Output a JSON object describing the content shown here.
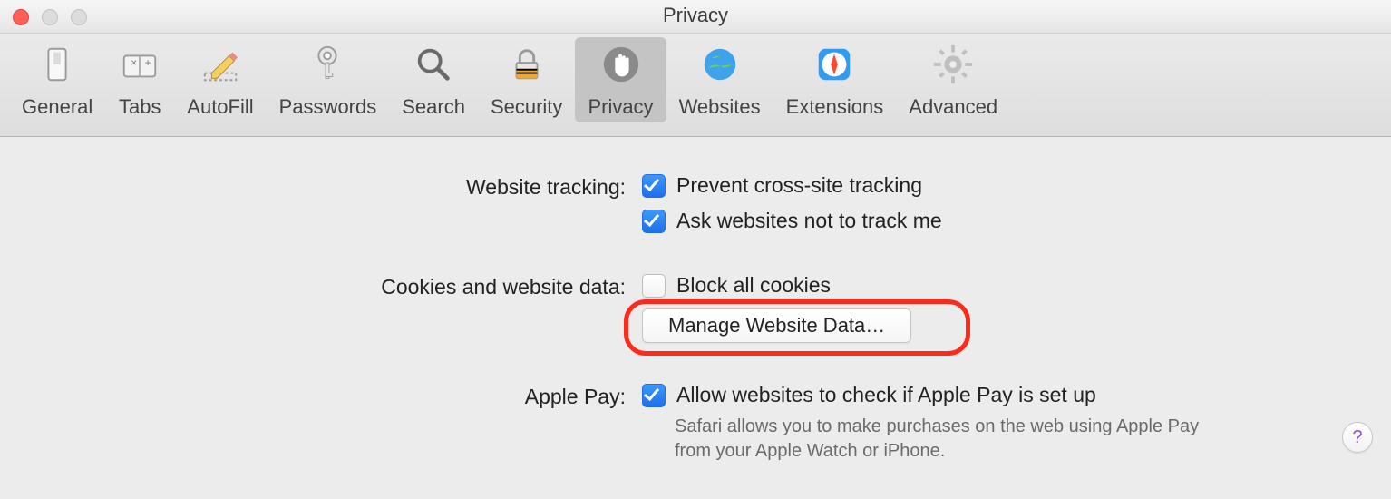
{
  "window": {
    "title": "Privacy"
  },
  "toolbar": {
    "items": [
      {
        "id": "general",
        "label": "General"
      },
      {
        "id": "tabs",
        "label": "Tabs"
      },
      {
        "id": "autofill",
        "label": "AutoFill"
      },
      {
        "id": "passwords",
        "label": "Passwords"
      },
      {
        "id": "search",
        "label": "Search"
      },
      {
        "id": "security",
        "label": "Security"
      },
      {
        "id": "privacy",
        "label": "Privacy"
      },
      {
        "id": "websites",
        "label": "Websites"
      },
      {
        "id": "extensions",
        "label": "Extensions"
      },
      {
        "id": "advanced",
        "label": "Advanced"
      }
    ],
    "selected": "privacy"
  },
  "sections": {
    "tracking": {
      "label": "Website tracking:",
      "opt1": "Prevent cross-site tracking",
      "opt2": "Ask websites not to track me"
    },
    "cookies": {
      "label": "Cookies and website data:",
      "opt1": "Block all cookies",
      "button": "Manage Website Data…"
    },
    "applepay": {
      "label": "Apple Pay:",
      "opt1": "Allow websites to check if Apple Pay is set up",
      "help": "Safari allows you to make purchases on the web using Apple Pay from your Apple Watch or iPhone."
    }
  },
  "help_button": "?"
}
